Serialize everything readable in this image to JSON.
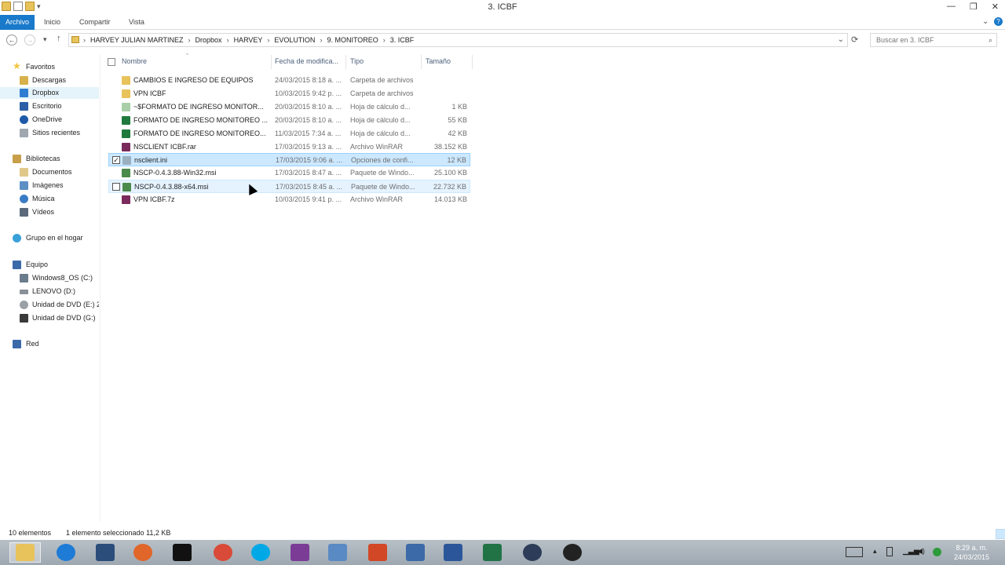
{
  "window": {
    "title": "3. ICBF",
    "minimize": "—",
    "restore": "❐",
    "close": "✕"
  },
  "ribbon": {
    "tabs": [
      "Archivo",
      "Inicio",
      "Compartir",
      "Vista"
    ],
    "expand": "⌄",
    "help": "?"
  },
  "address": {
    "back": "←",
    "forward": "→",
    "recent": "▾",
    "up": "↑",
    "crumbs": [
      "HARVEY JULIAN MARTINEZ",
      "Dropbox",
      "HARVEY",
      "EVOLUTION",
      "9. MONITOREO",
      "3. ICBF"
    ],
    "separator": "›",
    "dropdown": "⌄",
    "refresh": "⟳"
  },
  "search": {
    "placeholder": "Buscar en 3. ICBF",
    "icon": "⌕"
  },
  "sidebar": {
    "groups": [
      {
        "label": "Favoritos",
        "icon": "star-icon",
        "color": "#f3c43c"
      },
      {
        "label": "Bibliotecas",
        "icon": "library-icon",
        "color": "#c8a04a"
      },
      {
        "label": "Grupo en el hogar",
        "icon": "homegroup-icon",
        "color": "#3aa0d8"
      },
      {
        "label": "Equipo",
        "icon": "computer-icon",
        "color": "#3c6aa8"
      },
      {
        "label": "Red",
        "icon": "network-icon",
        "color": "#3c6aa8"
      }
    ],
    "favorites": [
      {
        "label": "Descargas",
        "icon": "downloads-icon",
        "color": "#d7b24a"
      },
      {
        "label": "Dropbox",
        "icon": "dropbox-icon",
        "color": "#2e7dd1"
      },
      {
        "label": "Escritorio",
        "icon": "desktop-icon",
        "color": "#2d5fa6"
      },
      {
        "label": "OneDrive",
        "icon": "onedrive-icon",
        "color": "#1d5aa8"
      },
      {
        "label": "Sitios recientes",
        "icon": "recent-places-icon",
        "color": "#9fa7b0"
      }
    ],
    "libraries": [
      {
        "label": "Documentos",
        "icon": "documents-icon",
        "color": "#e0c88a"
      },
      {
        "label": "Imágenes",
        "icon": "pictures-icon",
        "color": "#5d8fc4"
      },
      {
        "label": "Música",
        "icon": "music-icon",
        "color": "#3a7cc4"
      },
      {
        "label": "Vídeos",
        "icon": "videos-icon",
        "color": "#5a6a7a"
      }
    ],
    "computer": [
      {
        "label": "Windows8_OS (C:)",
        "icon": "drive-c-icon",
        "color": "#6b7c8c"
      },
      {
        "label": "LENOVO (D:)",
        "icon": "drive-d-icon",
        "color": "#8a9099"
      },
      {
        "label": "Unidad de DVD (E:) 2",
        "icon": "dvd-drive-icon",
        "color": "#9aa0a6"
      },
      {
        "label": "Unidad de DVD (G:)",
        "icon": "dvd-drive-g-icon",
        "color": "#3a3a3a"
      }
    ]
  },
  "columns": {
    "name": "Nombre",
    "date": "Fecha de modifica...",
    "type": "Tipo",
    "size": "Tamaño",
    "sort_arrow": "ˆ"
  },
  "files": [
    {
      "name": "CAMBIOS E INGRESO DE EQUIPOS",
      "date": "24/03/2015 8:18 a. ...",
      "type": "Carpeta de archivos",
      "size": "",
      "icon": "folder-icon",
      "color": "#e8c25a"
    },
    {
      "name": "VPN ICBF",
      "date": "10/03/2015 9:42 p. ...",
      "type": "Carpeta de archivos",
      "size": "",
      "icon": "folder-icon",
      "color": "#e8c25a"
    },
    {
      "name": "~$FORMATO DE INGRESO MONITOR...",
      "date": "20/03/2015 8:10 a. ...",
      "type": "Hoja de cálculo d...",
      "size": "1 KB",
      "icon": "excel-temp-icon",
      "color": "#a9cfa9"
    },
    {
      "name": "FORMATO DE INGRESO MONITOREO ...",
      "date": "20/03/2015 8:10 a. ...",
      "type": "Hoja de cálculo d...",
      "size": "55 KB",
      "icon": "excel-icon",
      "color": "#1f7a3e"
    },
    {
      "name": "FORMATO DE INGRESO MONITOREO...",
      "date": "11/03/2015 7:34 a. ...",
      "type": "Hoja de cálculo d...",
      "size": "42 KB",
      "icon": "excel-icon",
      "color": "#1f7a3e"
    },
    {
      "name": "NSCLIENT ICBF.rar",
      "date": "17/03/2015 9:13 a. ...",
      "type": "Archivo WinRAR",
      "size": "38.152 KB",
      "icon": "winrar-icon",
      "color": "#7a2a5c"
    },
    {
      "name": "nsclient.ini",
      "date": "17/03/2015 9:06 a. ...",
      "type": "Opciones de confi...",
      "size": "12 KB",
      "icon": "ini-file-icon",
      "color": "#9ab0c0"
    },
    {
      "name": "NSCP-0.4.3.88-Win32.msi",
      "date": "17/03/2015 8:47 a. ...",
      "type": "Paquete de Windo...",
      "size": "25.100 KB",
      "icon": "msi-icon",
      "color": "#4a8a4a"
    },
    {
      "name": "NSCP-0.4.3.88-x64.msi",
      "date": "17/03/2015 8:45 a. ...",
      "type": "Paquete de Windo...",
      "size": "22.732 KB",
      "icon": "msi-icon",
      "color": "#4a8a4a"
    },
    {
      "name": "VPN ICBF.7z",
      "date": "10/03/2015 9:41 p. ...",
      "type": "Archivo WinRAR",
      "size": "14.013 KB",
      "icon": "winrar-icon",
      "color": "#7a2a5c"
    }
  ],
  "status": {
    "count": "10 elementos",
    "selection": "1 elemento seleccionado  11,2 KB"
  },
  "taskbar": {
    "apps": [
      {
        "name": "explorer-icon",
        "color": "#e8c25a"
      },
      {
        "name": "internet-explorer-icon",
        "color": "#1e7bd6"
      },
      {
        "name": "lenovo-app-icon",
        "color": "#2a4d7a"
      },
      {
        "name": "firefox-icon",
        "color": "#e0662a"
      },
      {
        "name": "cmd-icon",
        "color": "#111111"
      },
      {
        "name": "chrome-icon",
        "color": "#d94a38"
      },
      {
        "name": "skype-icon",
        "color": "#00a8e6"
      },
      {
        "name": "onenote-icon",
        "color": "#7b3c96"
      },
      {
        "name": "remote-desktop-icon",
        "color": "#5a8ac4"
      },
      {
        "name": "powerpoint-icon",
        "color": "#d24726"
      },
      {
        "name": "network-settings-icon",
        "color": "#3c6aa8"
      },
      {
        "name": "word-icon",
        "color": "#2b579a"
      },
      {
        "name": "excel-icon",
        "color": "#217346"
      },
      {
        "name": "vpn-lock-icon",
        "color": "#2d3c58"
      },
      {
        "name": "obs-icon",
        "color": "#222222"
      }
    ],
    "clock_time": "8:29 a. m.",
    "clock_date": "24/03/2015"
  }
}
